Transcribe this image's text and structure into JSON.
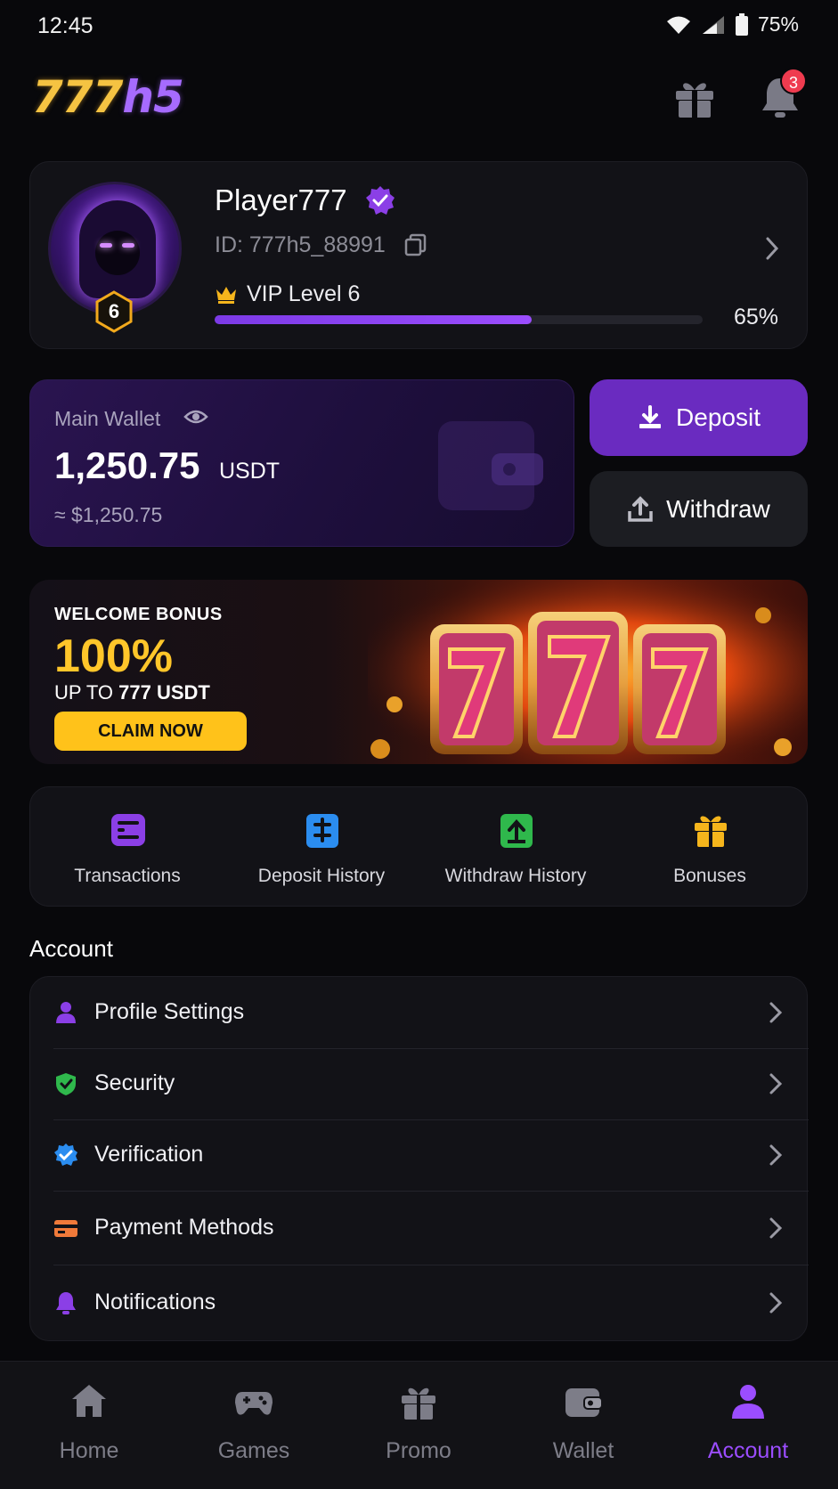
{
  "status_bar": {
    "time": "12:45",
    "battery": "75%"
  },
  "header": {
    "logo_part1": "777",
    "logo_part2": "h5",
    "notifications_badge": "3"
  },
  "profile": {
    "name": "Player777",
    "id_text": "ID: 777h5_88991",
    "vip_badge": "6",
    "vip_label": "VIP Level 6",
    "vip_progress": 0.65,
    "vip_progress_text": "65%"
  },
  "wallet": {
    "label": "Main Wallet",
    "amount": "1,250.75",
    "currency": "USDT",
    "approx": "≈ $1,250.75",
    "deposit_label": "Deposit",
    "withdraw_label": "Withdraw"
  },
  "banner": {
    "small": "WELCOME BONUS",
    "big": "100%",
    "upto_prefix": "UP TO ",
    "upto_value": "777 USDT",
    "cta": "CLAIM NOW"
  },
  "quick_actions": [
    {
      "label": "Transactions",
      "icon": "transactions-icon",
      "color": "#8b3fe6"
    },
    {
      "label": "Deposit History",
      "icon": "deposit-history-icon",
      "color": "#2b8df0"
    },
    {
      "label": "Withdraw History",
      "icon": "withdraw-history-icon",
      "color": "#2fb84c"
    },
    {
      "label": "Bonuses",
      "icon": "gift-icon",
      "color": "#f5b51c"
    }
  ],
  "account": {
    "title": "Account",
    "items": [
      {
        "label": "Profile Settings",
        "icon": "user-icon",
        "color": "#8b3fe6"
      },
      {
        "label": "Security",
        "icon": "shield-icon",
        "color": "#2fb84c"
      },
      {
        "label": "Verification",
        "icon": "verified-icon",
        "color": "#2b8df0"
      },
      {
        "label": "Payment Methods",
        "icon": "card-icon",
        "color": "#f07a3a"
      },
      {
        "label": "Notifications",
        "icon": "bell-icon",
        "color": "#8b3fe6"
      }
    ]
  },
  "bottom_nav": [
    {
      "label": "Home",
      "icon": "home-icon",
      "active": false
    },
    {
      "label": "Games",
      "icon": "gamepad-icon",
      "active": false
    },
    {
      "label": "Promo",
      "icon": "gift-icon",
      "active": false
    },
    {
      "label": "Wallet",
      "icon": "wallet-icon",
      "active": false
    },
    {
      "label": "Account",
      "icon": "user-icon",
      "active": true
    }
  ],
  "colors": {
    "accent": "#9b4dff",
    "gold": "#ffc21a",
    "background": "#08080b"
  }
}
